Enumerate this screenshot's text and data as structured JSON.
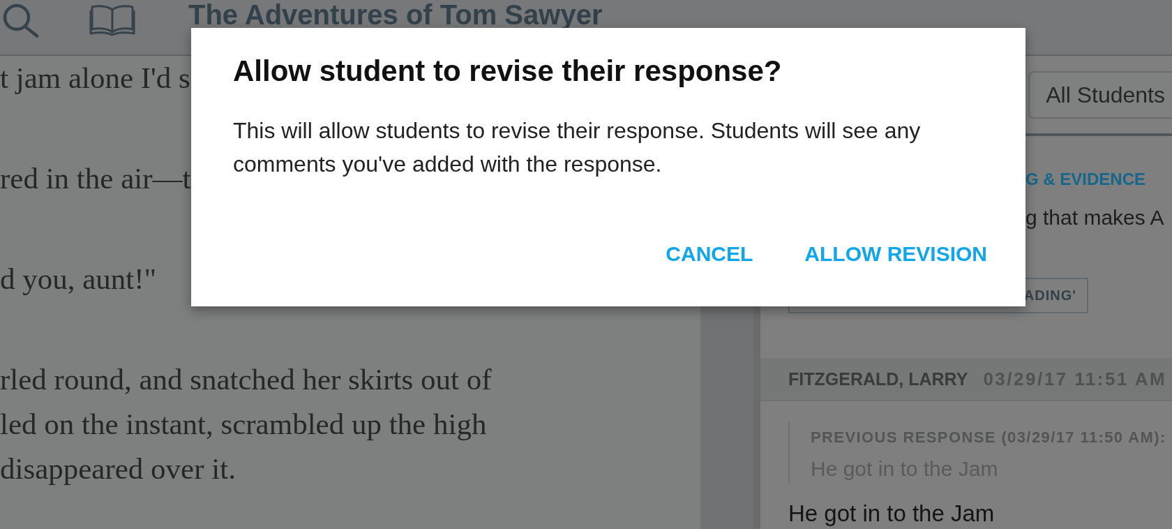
{
  "toolbar": {
    "title": "The Adventures of Tom Sawyer"
  },
  "reader": {
    "paragraphs": [
      {
        "lines": [
          "t jam alone I'd s"
        ]
      },
      {
        "lines": [
          "red in the air—t"
        ]
      },
      {
        "lines": [
          "d you, aunt!\""
        ]
      },
      {
        "lines": [
          "rled round, and snatched her skirts out of",
          "led on the instant, scrambled up the high",
          "disappeared over it."
        ]
      }
    ]
  },
  "responses_panel": {
    "filter": {
      "label": "All Students"
    },
    "question": {
      "category": "G & EVIDENCE",
      "text": "g that makes A",
      "tag": "ADING'"
    },
    "response": {
      "student": "FITZGERALD, LARRY",
      "time": "03/29/17 11:51 AM",
      "previous": {
        "label": "PREVIOUS RESPONSE (03/29/17 11:50 AM):",
        "text": "He got in to the Jam"
      },
      "text": "He got in to the Jam"
    }
  },
  "dialog": {
    "title": "Allow student to revise their response?",
    "message": "This will allow students to revise their response. Students will see any comments you've added with the response.",
    "buttons": [
      "CANCEL",
      "ALLOW REVISION"
    ]
  }
}
